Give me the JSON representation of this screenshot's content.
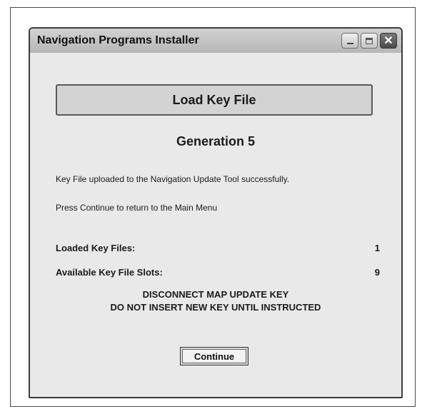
{
  "window": {
    "title": "Navigation Programs Installer",
    "controls": {
      "minimize_icon": "minimize-icon",
      "maximize_icon": "maximize-icon",
      "close_icon": "close-icon",
      "close_glyph": "✕"
    }
  },
  "panel": {
    "header": "Load Key File",
    "generation": "Generation 5",
    "message_success": "Key File uploaded to the Navigation Update Tool successfully.",
    "message_continue": "Press Continue to return to the Main Menu",
    "stats": [
      {
        "label": "Loaded Key Files:",
        "value": "1"
      },
      {
        "label": "Available Key File Slots:",
        "value": "9"
      }
    ],
    "warning_line1": "DISCONNECT MAP UPDATE KEY",
    "warning_line2": "DO NOT INSERT NEW KEY UNTIL INSTRUCTED",
    "continue_label": "Continue"
  }
}
